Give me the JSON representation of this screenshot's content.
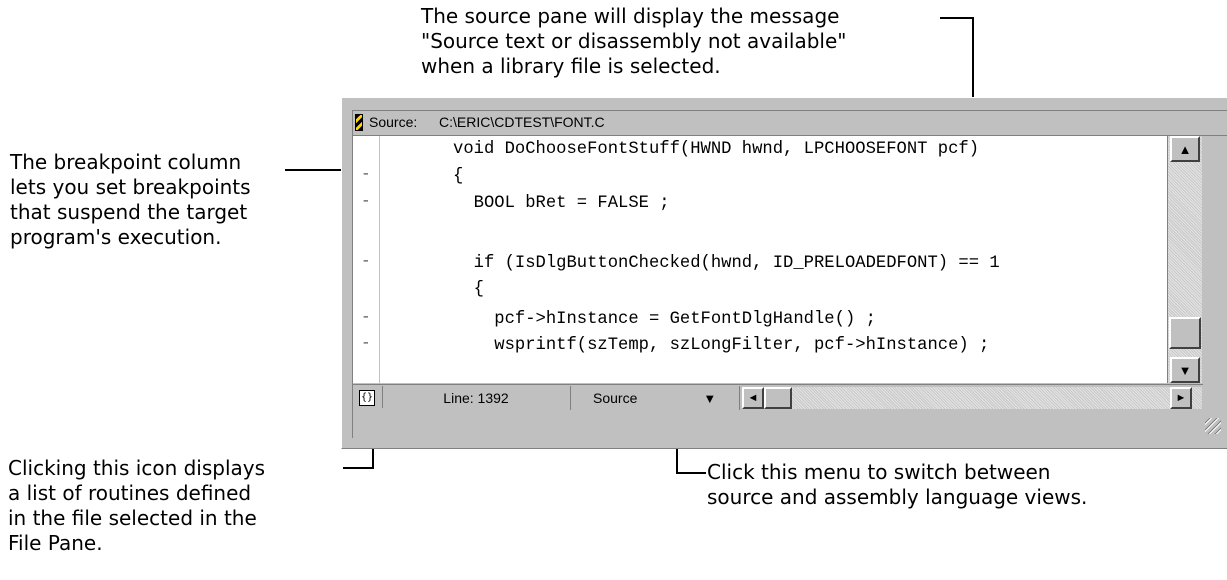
{
  "callouts": {
    "top": [
      "The source pane will display the message",
      "\"Source text or disassembly not available\"",
      "when a library file is selected."
    ],
    "left": [
      "The breakpoint column",
      "lets you set breakpoints",
      "that suspend the target",
      "program's execution."
    ],
    "bottom_left": [
      "Clicking this icon displays",
      "a list of routines defined",
      "in the file selected in the",
      "File Pane."
    ],
    "bottom_right": [
      "Click this menu to switch between",
      "source and assembly language views."
    ]
  },
  "window": {
    "title_label": "Source:",
    "title_path": "C:\\ERIC\\CDTEST\\FONT.C"
  },
  "code_lines": [
    "void DoChooseFontStuff(HWND hwnd, LPCHOOSEFONT pcf)",
    "{",
    "  BOOL bRet = FALSE ;",
    "",
    "  if (IsDlgButtonChecked(hwnd, ID_PRELOADEDFONT) == 1",
    "  {",
    "    pcf->hInstance = GetFontDlgHandle() ;",
    "    wsprintf(szTemp, szLongFilter, pcf->hInstance) ;"
  ],
  "breakpoint_marks": [
    "",
    "-",
    "-",
    "",
    "-",
    "",
    "-",
    "-"
  ],
  "status": {
    "routines_icon": "{}",
    "line_label": "Line: 1392",
    "view_menu_value": "Source",
    "dropdown_icon": "▼"
  },
  "icons": {
    "scroll_up": "▲",
    "scroll_down": "▼",
    "scroll_left": "◄",
    "scroll_right": "►"
  }
}
